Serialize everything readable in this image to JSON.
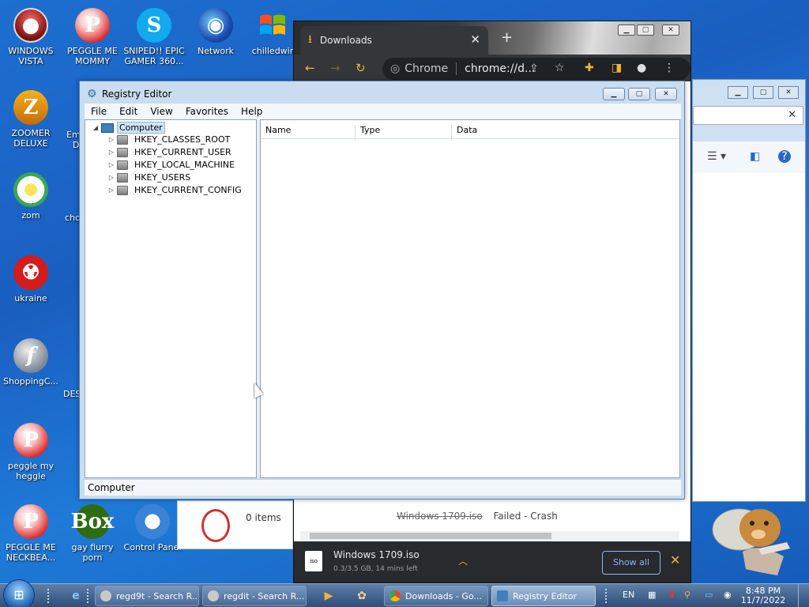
{
  "desktop_icons": [
    {
      "label": "WINDOWS VISTA",
      "glyph": "●"
    },
    {
      "label": "PEGGLE ME MOMMY",
      "glyph": "P"
    },
    {
      "label": "SNIPED!! EPIC GAMER 360...",
      "glyph": "S"
    },
    {
      "label": "Network",
      "glyph": "◉"
    },
    {
      "label": "chilledwir",
      "glyph": "⊞"
    },
    {
      "label": "ZOOMER DELUXE",
      "glyph": "Z"
    },
    {
      "label": "zom",
      "glyph": "✿"
    },
    {
      "label": "ukraine",
      "glyph": "☢"
    },
    {
      "label": "ShoppingC...",
      "glyph": "f"
    },
    {
      "label": "peggle my heggle",
      "glyph": "P"
    },
    {
      "label": "PEGGLE ME NECKBEA...",
      "glyph": "P"
    },
    {
      "label": "gay fiurry porn",
      "glyph": "Box"
    },
    {
      "label": "Control Panel",
      "glyph": "⊕"
    }
  ],
  "partial_labels": [
    "Em",
    "D",
    "cho",
    "DES"
  ],
  "chrome": {
    "tab_title": "Downloads",
    "tab_close": "✕",
    "new_tab": "+",
    "omnibox_label": "Chrome",
    "omnibox_url": "chrome://d...",
    "download_row_file": "Windows 1709.iso",
    "download_row_status": "Failed - Crash",
    "shelf_file_icon": "iso",
    "shelf_file": "Windows 1709.iso",
    "shelf_status": "0.3/3.5 GB, 14 mins left",
    "show_all": "Show all",
    "shelf_close": "✕"
  },
  "explorer_fragment": {
    "items_count": "0 items"
  },
  "regedit": {
    "title": "Registry Editor",
    "menu": [
      "File",
      "Edit",
      "View",
      "Favorites",
      "Help"
    ],
    "tree_root": "Computer",
    "hives": [
      "HKEY_CLASSES_ROOT",
      "HKEY_CURRENT_USER",
      "HKEY_LOCAL_MACHINE",
      "HKEY_USERS",
      "HKEY_CURRENT_CONFIG"
    ],
    "columns": [
      "Name",
      "Type",
      "Data"
    ],
    "status": "Computer"
  },
  "taskbar": {
    "tasks": [
      {
        "label": "regd9t - Search R...",
        "icon_color": "#c9c9c9"
      },
      {
        "label": "regdit - Search R...",
        "icon_color": "#c9c9c9"
      },
      {
        "label": "Downloads - Go...",
        "icon_color": "#34a853"
      },
      {
        "label": "Registry Editor",
        "icon_color": "#3f7fc0"
      }
    ],
    "language": "EN",
    "time": "8:48 PM",
    "date": "11/7/2022"
  }
}
